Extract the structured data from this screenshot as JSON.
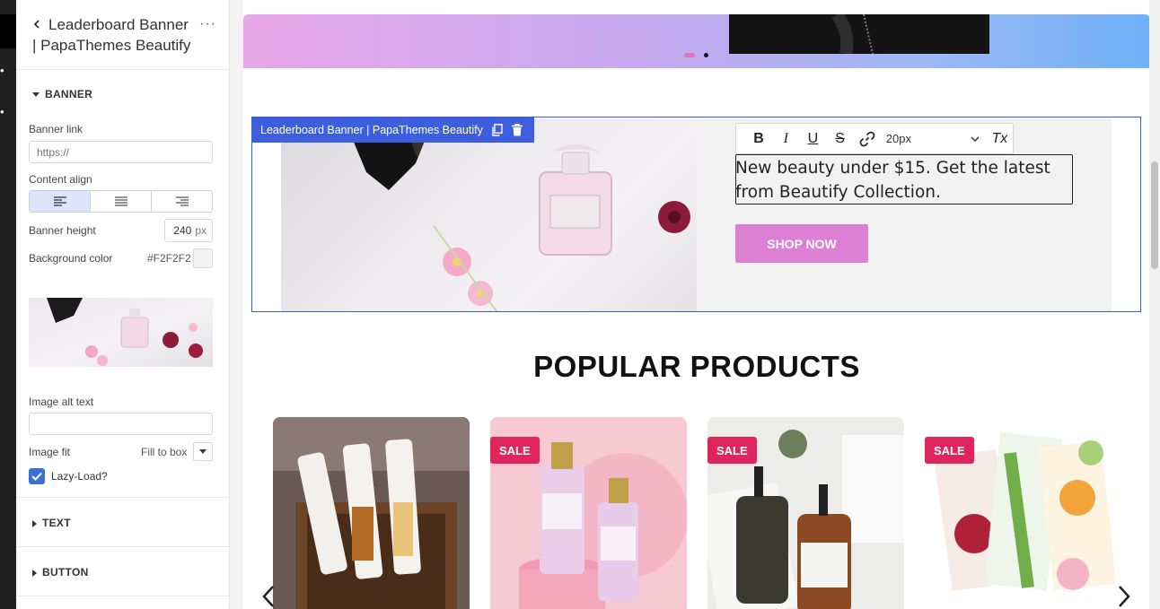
{
  "panel": {
    "title": "Leaderboard Banner",
    "title_line2": "| PapaThemes Beautify",
    "more": "···",
    "sections": {
      "banner": "BANNER",
      "text": "TEXT",
      "button": "BUTTON"
    },
    "banner_link": {
      "label": "Banner link",
      "placeholder": "https://"
    },
    "content_align": {
      "label": "Content align",
      "selected": "left"
    },
    "banner_height": {
      "label": "Banner height",
      "value": "240",
      "unit": "px"
    },
    "background_color": {
      "label": "Background color",
      "value": "#F2F2F2"
    },
    "image_alt": {
      "label": "Image alt text",
      "value": ""
    },
    "image_fit": {
      "label": "Image fit",
      "value": "Fill to box"
    },
    "lazy_load": {
      "label": "Lazy-Load?",
      "checked": true
    }
  },
  "canvas": {
    "block_tag": "Leaderboard Banner | PapaThemes Beautify",
    "toolbar": {
      "bold": "B",
      "italic": "I",
      "underline": "U",
      "strike": "S",
      "font_size": "20px",
      "clear": "Tx"
    },
    "headline": "New beauty under $15. Get the latest from Beautify Collection.",
    "shop_button": "SHOP NOW",
    "popular_title": "POPULAR PRODUCTS",
    "sale_badge": "SALE",
    "colors": {
      "accent_blue": "#3d5fde",
      "shop_button": "#dd7fd3",
      "sale": "#e0245e",
      "banner_bg": "#F2F2F2"
    }
  }
}
